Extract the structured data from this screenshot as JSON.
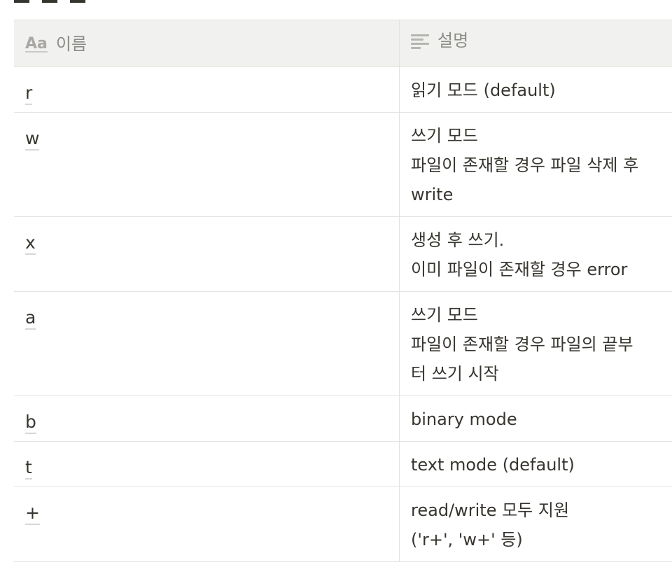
{
  "table": {
    "headers": {
      "name_icon": "Aa",
      "name": "이름",
      "desc": "설명"
    },
    "rows": [
      {
        "name": "r",
        "desc": [
          "읽기 모드 (default)"
        ]
      },
      {
        "name": "w",
        "desc": [
          "쓰기 모드",
          "파일이 존재할 경우 파일 삭제 후",
          "write"
        ]
      },
      {
        "name": "x",
        "desc": [
          "생성 후 쓰기.",
          "이미 파일이 존재할 경우 error"
        ]
      },
      {
        "name": "a",
        "desc": [
          "쓰기 모드",
          "파일이 존재할 경우 파일의 끝부",
          "터 쓰기 시작"
        ]
      },
      {
        "name": "b",
        "desc": [
          "binary mode"
        ]
      },
      {
        "name": "t",
        "desc": [
          "text mode (default)"
        ]
      },
      {
        "name": "+",
        "desc": [
          "read/write 모두 지원",
          "('r+', 'w+' 등)"
        ]
      }
    ]
  }
}
